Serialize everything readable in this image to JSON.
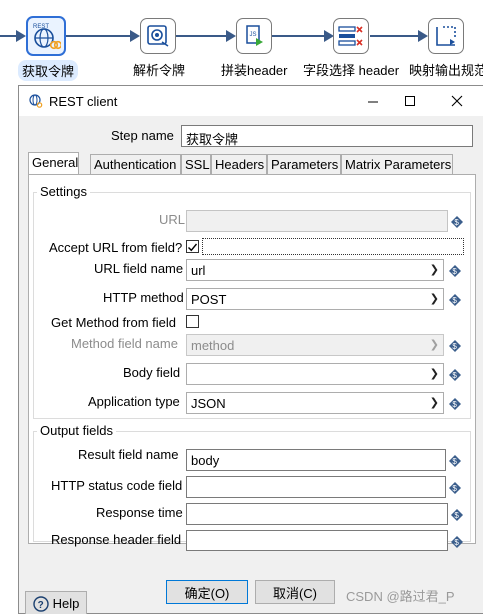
{
  "pipeline": {
    "steps": [
      {
        "label": "获取令牌",
        "icon": "rest-client-icon"
      },
      {
        "label": "解析令牌",
        "icon": "json-input-icon"
      },
      {
        "label": "拼装header",
        "icon": "javascript-icon"
      },
      {
        "label": "字段选择 header",
        "icon": "select-values-icon"
      },
      {
        "label": "映射输出规范",
        "icon": "output-mapping-icon"
      }
    ]
  },
  "dialog": {
    "title": "REST client",
    "step_name_label": "Step name",
    "step_name_value": "获取令牌",
    "tabs": [
      "General",
      "Authentication",
      "SSL",
      "Headers",
      "Parameters",
      "Matrix Parameters"
    ],
    "settings": {
      "title": "Settings",
      "url_label": "URL",
      "url_value": "",
      "accept_url_label": "Accept URL from field?",
      "accept_url_checked": true,
      "url_field_label": "URL field name",
      "url_field_value": "url",
      "http_method_label": "HTTP method",
      "http_method_value": "POST",
      "get_method_label": "Get Method from field",
      "get_method_checked": false,
      "method_field_label": "Method field name",
      "method_field_value": "method",
      "body_field_label": "Body field",
      "body_field_value": "",
      "app_type_label": "Application type",
      "app_type_value": "JSON"
    },
    "output": {
      "title": "Output fields",
      "result_label": "Result field name",
      "result_value": "body",
      "status_label": "HTTP status code field",
      "status_value": "",
      "response_time_label": "Response time",
      "response_time_value": "",
      "response_header_label": "Response header field",
      "response_header_value": ""
    },
    "buttons": {
      "help": "Help",
      "ok": "确定(O)",
      "cancel": "取消(C)"
    }
  },
  "watermark": "CSDN @路过君_P",
  "colors": {
    "accent": "#2f6fd6",
    "pipeline_line": "#3a5a88",
    "variable_icon": "#3b5e8c"
  }
}
